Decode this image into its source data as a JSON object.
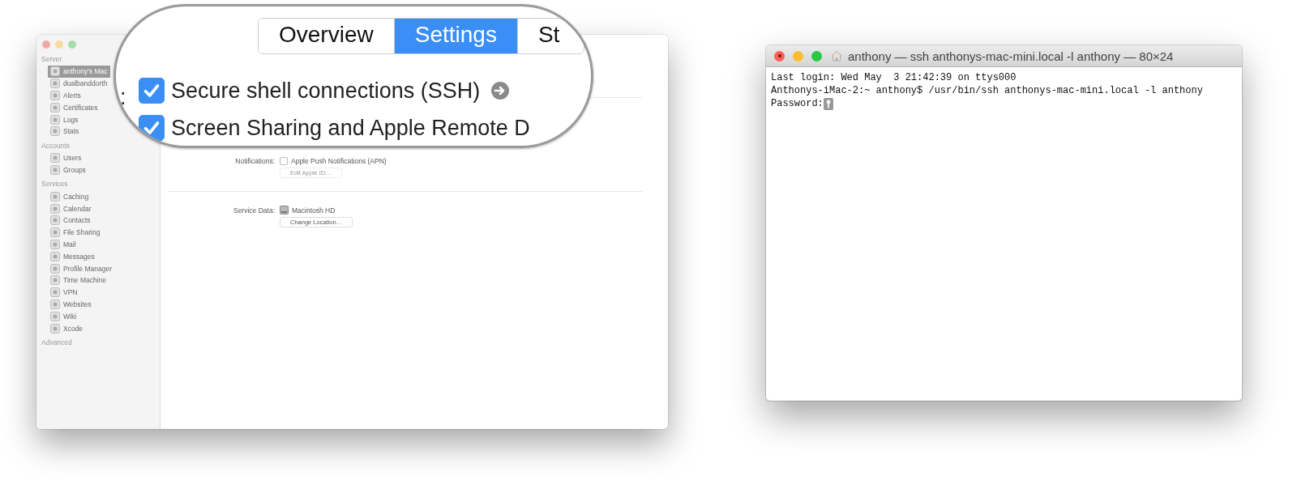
{
  "server_window": {
    "sidebar": {
      "sections": [
        {
          "heading": "Server",
          "items": [
            {
              "label": "anthony's Mac",
              "selected": true
            },
            {
              "label": "dualbanddorth",
              "selected": false
            },
            {
              "label": "Alerts",
              "selected": false
            },
            {
              "label": "Certificates",
              "selected": false
            },
            {
              "label": "Logs",
              "selected": false
            },
            {
              "label": "Stats",
              "selected": false
            }
          ]
        },
        {
          "heading": "Accounts",
          "items": [
            {
              "label": "Users",
              "selected": false
            },
            {
              "label": "Groups",
              "selected": false
            }
          ]
        },
        {
          "heading": "Services",
          "items": [
            {
              "label": "Caching",
              "selected": false
            },
            {
              "label": "Calendar",
              "selected": false
            },
            {
              "label": "Contacts",
              "selected": false
            },
            {
              "label": "File Sharing",
              "selected": false
            },
            {
              "label": "Mail",
              "selected": false
            },
            {
              "label": "Messages",
              "selected": false
            },
            {
              "label": "Profile Manager",
              "selected": false
            },
            {
              "label": "Time Machine",
              "selected": false
            },
            {
              "label": "VPN",
              "selected": false
            },
            {
              "label": "Websites",
              "selected": false
            },
            {
              "label": "Wiki",
              "selected": false
            },
            {
              "label": "Xcode",
              "selected": false
            }
          ]
        },
        {
          "heading": "Advanced"
        }
      ]
    },
    "notifications": {
      "label": "Notifications:",
      "option": "Apple Push Notifications (APN)",
      "checked": false,
      "button": "Edit Apple ID…",
      "button_disabled": true
    },
    "service_data": {
      "label": "Service Data:",
      "disk": "Macintosh HD",
      "button": "Change Location…"
    }
  },
  "magnifier": {
    "tabs": [
      {
        "label": "Overview",
        "selected": false
      },
      {
        "label": "Settings",
        "selected": true
      },
      {
        "label": "St",
        "selected": false
      }
    ],
    "label_tail": ":",
    "options": [
      {
        "label": "Secure shell connections (SSH)",
        "checked": true,
        "has_arrow": true
      },
      {
        "label": "Screen Sharing and Apple Remote D",
        "checked": true,
        "has_arrow": false
      }
    ]
  },
  "terminal": {
    "title": "anthony — ssh anthonys-mac-mini.local -l anthony — 80×24",
    "lines": [
      "Last login: Wed May  3 21:42:39 on ttys000",
      "Anthonys-iMac-2:~ anthony$ /usr/bin/ssh anthonys-mac-mini.local -l anthony",
      "Password:"
    ]
  }
}
